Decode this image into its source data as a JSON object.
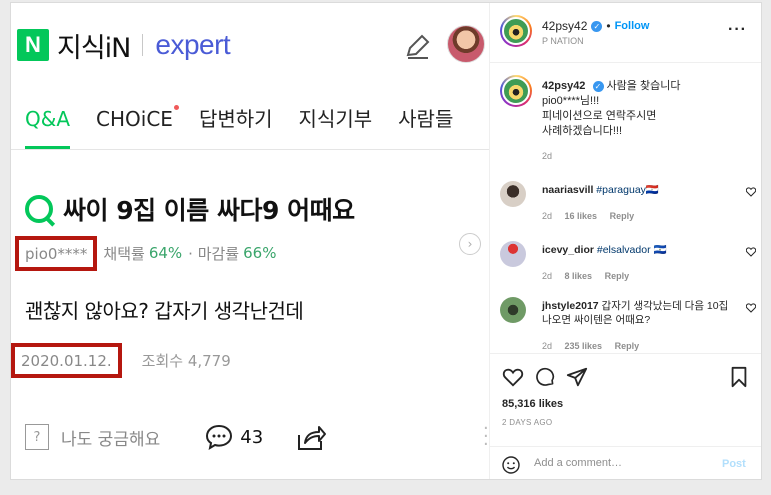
{
  "kin": {
    "brand_letter": "N",
    "title": "지식iN",
    "expert": "expert",
    "tabs": [
      {
        "label": "Q&A"
      },
      {
        "label": "CHOiCE"
      },
      {
        "label": "답변하기"
      },
      {
        "label": "지식기부"
      },
      {
        "label": "사람들"
      }
    ],
    "question": {
      "title": "싸이 9집 이름 싸다9 어때요",
      "author": "pio0****",
      "adopt_label": "채택률",
      "adopt_rate": "64%",
      "deadline_label": "· 마감률",
      "deadline_rate": "66%",
      "body": "괜찮지 않아요? 갑자기 생각난건데",
      "date": "2020.01.12.",
      "views": "조회수 4,779",
      "curious_label": "나도 궁금해요",
      "comment_count": "43"
    }
  },
  "ig": {
    "username": "42psy42",
    "bullet": "•",
    "follow": "Follow",
    "subtitle": "P NATION",
    "caption": {
      "user": "42psy42",
      "line1": "사람을 찾습니다",
      "line2": "pio0****님!!!",
      "line3": "피네이션으로 연락주시면",
      "line4": "사례하겠습니다!!!",
      "time": "2d"
    },
    "comments": [
      {
        "user": "naariasvill",
        "text": "#paraguay🇵🇾",
        "time": "2d",
        "likes": "16 likes",
        "reply": "Reply"
      },
      {
        "user": "icevy_dior",
        "text": "#elsalvador 🇸🇻",
        "time": "2d",
        "likes": "8 likes",
        "reply": "Reply"
      },
      {
        "user": "jhstyle2017",
        "text": "갑자기 생각났는데 다음 10집 나오면 싸이텐은 어때요?",
        "time": "2d",
        "likes": "235 likes",
        "reply": "Reply"
      }
    ],
    "likes": "85,316 likes",
    "ago": "2 DAYS AGO",
    "add_comment_placeholder": "Add a comment…",
    "post": "Post"
  }
}
